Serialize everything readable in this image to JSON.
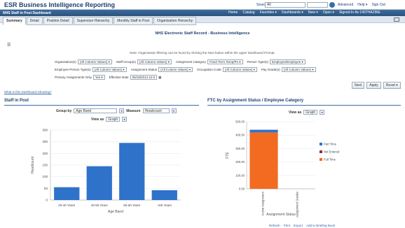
{
  "app": {
    "title": "ESR Business Intelligence Reporting"
  },
  "search": {
    "label": "Search",
    "scope": "All"
  },
  "top_links": [
    "Advanced",
    "Help ▾",
    "Sign Out"
  ],
  "dashboard": {
    "title": "NHS Staff in Post Dashboard"
  },
  "nav_links": [
    "Home",
    "Catalog",
    "Favorites ▾",
    "Dashboards ▾",
    "New ▾",
    "Open ▾",
    "Signed In As  1407HAZINE"
  ],
  "tabs": [
    "Summary",
    "Detail",
    "Position Detail",
    "Supervisor Hierarchy",
    "Monthly Staff in Post",
    "Organisation Hierarchy"
  ],
  "page_heading": "NHS Electronic Staff Record - Business Intelligence",
  "note": "Note: Organisation filtering can be found by clicking the Next button within the upper Dashboard Prompt.",
  "prompts": {
    "row1": [
      {
        "label": "Organisation(s)",
        "value": "(All Column Values)"
      },
      {
        "label": "Staff Group(s)",
        "value": "(All Column Values)"
      },
      {
        "label": "Assignment Category",
        "value": "Fixed Term Temp/Pe"
      },
      {
        "label": "Person Type(s)",
        "value": "Employee/Employee"
      }
    ],
    "row2": [
      {
        "label": "Employee Person Type(s)",
        "value": "(All Column Values)"
      },
      {
        "label": "Assignment Status",
        "value": "(All Column Values)"
      },
      {
        "label": "Occupation Code",
        "value": "(All Column Values)"
      },
      {
        "label": "Pay Grade(s)",
        "value": "(All Column Values)"
      }
    ],
    "row3": [
      {
        "label": "Primary Assignments Only",
        "value": "Yes"
      },
      {
        "label": "Effective Date",
        "value": "06/18/2014 12:0"
      }
    ]
  },
  "buttons": {
    "next": "Next",
    "apply": "Apply",
    "reset": "Reset ▾"
  },
  "help_link": "What is this Dashboard Showing?",
  "staff_in_post": {
    "heading": "Staff in Post",
    "group_by_label": "Group by",
    "group_by_value": "Age Band",
    "measure_label": "Measure",
    "measure_value": "Headcount",
    "view_as_label": "View as",
    "view_as_value": "Graph"
  },
  "ftc": {
    "heading": "FTC by Assignment Status / Employee Category",
    "view_as_label": "View as",
    "view_as_value": "Graph"
  },
  "footer_links": [
    "Refresh",
    "Print",
    "Export",
    "Add to Briefing Book"
  ],
  "chart_data": [
    {
      "type": "bar",
      "categories": [
        "20-40 Years",
        "40-50 Years",
        "50-60 Years",
        ">60 Years"
      ],
      "values": [
        55,
        145,
        245,
        42
      ],
      "xlabel": "Age Band",
      "ylabel": "Headcount",
      "ylim": [
        0,
        300
      ],
      "yticks": [
        "0",
        "50",
        "100",
        "150",
        "200",
        "250",
        "300"
      ],
      "color": "#2f72c9"
    },
    {
      "type": "bar",
      "stacked": true,
      "categories": [
        "Active Assignment",
        "Assignment Grades"
      ],
      "series": [
        {
          "name": "Full Time",
          "values": [
            420,
            0
          ],
          "color": "#f26b21"
        },
        {
          "name": "Not Entered",
          "values": [
            0,
            0
          ],
          "color": "#8e2f4a"
        },
        {
          "name": "Part Time",
          "values": [
            20,
            0
          ],
          "color": "#2f72c9"
        }
      ],
      "xlabel": "Assignment Status",
      "ylabel": "FTE",
      "ylim": [
        0,
        500
      ],
      "yticks": [
        "0.00",
        "100.00",
        "200.00",
        "300.00",
        "400.00",
        "500.00"
      ],
      "legend": "right"
    }
  ]
}
